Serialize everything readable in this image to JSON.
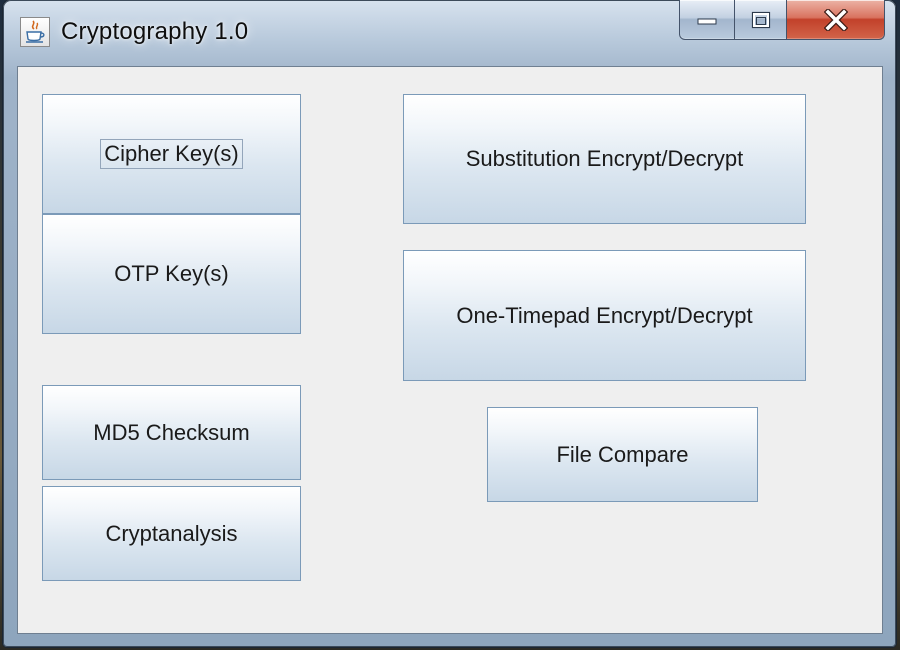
{
  "window": {
    "title": "Cryptography 1.0",
    "app_icon": "java-cup-icon",
    "caption_buttons": {
      "minimize": "minimize-icon",
      "maximize": "maximize-icon",
      "close": "close-icon"
    }
  },
  "buttons": {
    "cipher_keys": "Cipher Key(s)",
    "otp_keys": "OTP Key(s)",
    "md5_checksum": "MD5 Checksum",
    "cryptanalysis": "Cryptanalysis",
    "substitution": "Substitution Encrypt/Decrypt",
    "one_timepad": "One-Timepad Encrypt/Decrypt",
    "file_compare": "File Compare"
  },
  "state": {
    "focused_button": "cipher_keys"
  },
  "colors": {
    "client_background": "#efefef",
    "button_border": "#7b9ab8",
    "close_button": "#c2412a"
  }
}
